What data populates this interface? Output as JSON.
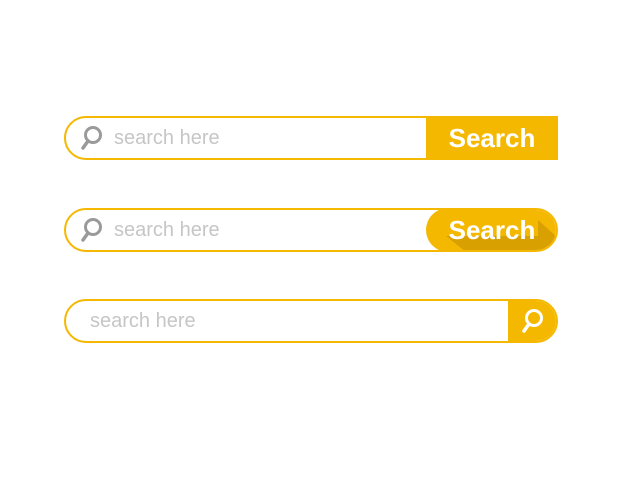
{
  "colors": {
    "accent": "#f5b800",
    "accent_shadow": "#d8a000",
    "placeholder": "#c6c6c6",
    "icon_gray": "#9a9a9a",
    "button_text": "#ffffff"
  },
  "bars": [
    {
      "style": "square-button",
      "icon": "search-icon",
      "placeholder": "search here",
      "button_label": "Search"
    },
    {
      "style": "rounded-button",
      "icon": "search-icon",
      "placeholder": "search here",
      "button_label": "Search"
    },
    {
      "style": "icon-button",
      "placeholder": "search here",
      "button_icon": "search-icon"
    }
  ]
}
